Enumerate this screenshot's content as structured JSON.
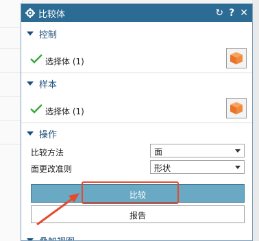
{
  "dialog": {
    "title": "比较体",
    "title_icon": "gear-icon",
    "actions": [
      "reset-icon",
      "help-icon",
      "close-icon"
    ],
    "reset_glyph": "↻",
    "help_glyph": "?",
    "close_glyph": "✕"
  },
  "sections": {
    "control": {
      "header": "控制",
      "selection_label": "选择体 (1)"
    },
    "sample": {
      "header": "样本",
      "selection_label": "选择体 (1)"
    },
    "operation": {
      "header": "操作",
      "compare_method_label": "比较方法",
      "compare_method_value": "面",
      "face_change_rule_label": "面更改准则",
      "face_change_rule_value": "形状",
      "compare_button": "比较",
      "report_button": "报告"
    },
    "overlay_views": {
      "header": "叠加视图"
    }
  },
  "colors": {
    "titlebar": "#2c6b94",
    "section_header": "#1c4f7a",
    "compare_button": "#6aa9c4",
    "highlight": "#e64a2e",
    "cube": "#f08a3c"
  }
}
